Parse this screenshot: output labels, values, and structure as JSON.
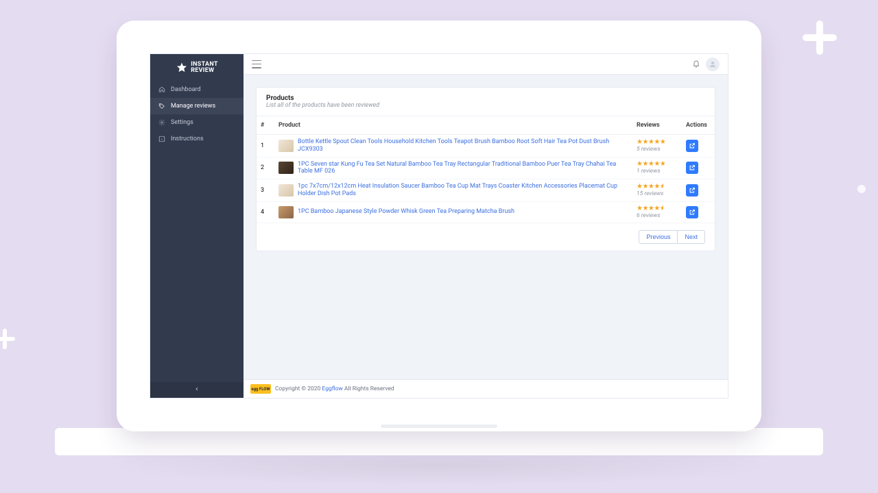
{
  "brand": {
    "line1": "INSTANT",
    "line2": "REVIEW"
  },
  "sidebar": {
    "items": [
      {
        "label": "Dashboard"
      },
      {
        "label": "Manage reviews"
      },
      {
        "label": "Settings"
      },
      {
        "label": "Instructions"
      }
    ]
  },
  "card": {
    "title": "Products",
    "subtitle": "List all of the products have been reviewed"
  },
  "columns": {
    "num": "#",
    "product": "Product",
    "reviews": "Reviews",
    "actions": "Actions"
  },
  "rows": [
    {
      "num": "1",
      "name": "Bottle Kettle Spout Clean Tools Household Kitchen Tools Teapot Brush Bamboo Root Soft Hair Tea Pot Dust Brush JCX9303",
      "stars": "★★★★★",
      "review_count": "5 reviews",
      "thumb_class": "light"
    },
    {
      "num": "2",
      "name": "1PC Seven star Kung Fu Tea Set Natural Bamboo Tea Tray Rectangular Traditional Bamboo Puer Tea Tray Chahai Tea Table MF 026",
      "stars": "★★★★★",
      "review_count": "1 reviews",
      "thumb_class": "dark"
    },
    {
      "num": "3",
      "name": "1pc 7x7cm/12x12cm Heat Insulation Saucer Bamboo Tea Cup Mat Trays Coaster Kitchen Accessories Placemat Cup Holder Dish Pot Pads",
      "stars": "★★★★½",
      "review_count": "15 reviews",
      "thumb_class": "light"
    },
    {
      "num": "4",
      "name": "1PC Bamboo Japanese Style Powder Whisk Green Tea Preparing Matcha Brush",
      "stars": "★★★★½",
      "review_count": "6 reviews",
      "thumb_class": ""
    }
  ],
  "pagination": {
    "prev": "Previous",
    "next": "Next"
  },
  "footer": {
    "badge": "egg FLOW",
    "copyright_pre": "Copyright © 2020 ",
    "link": "Eggflow",
    "copyright_post": " All Rights Reserved"
  }
}
